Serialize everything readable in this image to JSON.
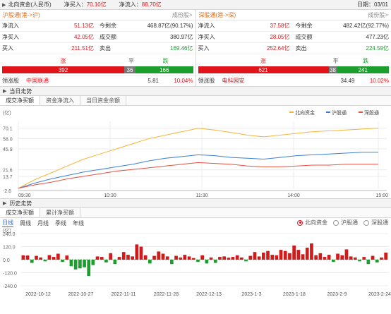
{
  "topbar": {
    "title": "北向资金(人民币)",
    "net_buy_label": "净买入：",
    "net_buy_value": "70.10亿",
    "net_inflow_label": "净流入：",
    "net_inflow_value": "88.70亿",
    "date_label": "日期：",
    "date_value": "03/01"
  },
  "left_panel": {
    "title": "沪股通(港->沪)",
    "more": "成份股>",
    "rows": [
      {
        "l1": "净流入",
        "v1": "51.13亿",
        "l2": "今剩余",
        "v2": "468.87亿(90.17%)"
      },
      {
        "l1": "净买入",
        "v1": "42.05亿",
        "l2": "成交额",
        "v2": "380.97亿"
      },
      {
        "l1": "买入",
        "v1": "211.51亿",
        "l2": "卖出",
        "v2": "169.46亿"
      }
    ],
    "up_label": "涨",
    "flat_label": "平",
    "down_label": "跌",
    "up_count": "392",
    "flat_count": "36",
    "down_count": "166",
    "lead_label": "领涨股",
    "lead_name": "中国联通",
    "lead_price": "5.81",
    "lead_pct": "10.04%"
  },
  "right_panel": {
    "title": "深股通(港->深)",
    "more": "成份股>",
    "rows": [
      {
        "l1": "净流入",
        "v1": "37.58亿",
        "l2": "今剩余",
        "v2": "482.42亿(92.77%)"
      },
      {
        "l1": "净买入",
        "v1": "28.05亿",
        "l2": "成交额",
        "v2": "477.23亿"
      },
      {
        "l1": "买入",
        "v1": "252.64亿",
        "l2": "卖出",
        "v2": "224.59亿"
      }
    ],
    "up_label": "涨",
    "flat_label": "平",
    "down_label": "跌",
    "up_count": "621",
    "flat_count": "38",
    "down_count": "241",
    "lead_label": "领涨股",
    "lead_name": "电科网安",
    "lead_price": "34.49",
    "lead_pct": "10.02%"
  },
  "intraday_section": {
    "title": "当日走势",
    "tabs": [
      "成交净买额",
      "资金净流入",
      "当日资金余额"
    ]
  },
  "history_section": {
    "title": "历史走势",
    "tabs": [
      "成交净买额",
      "累计净买额"
    ],
    "periods": [
      "日线",
      "周线",
      "月线",
      "季线",
      "年线"
    ],
    "radios": [
      "北向资金",
      "沪股通",
      "深股通"
    ]
  },
  "chart_data": [
    {
      "type": "line",
      "unit_label": "(亿)",
      "y_ticks": [
        -2.6,
        13.7,
        21.6,
        45.9,
        58.0,
        70.1
      ],
      "ylim": [
        -2.6,
        78
      ],
      "x_tick_labels": [
        "09:30",
        "10:30",
        "11:30",
        "14:00",
        "15:00"
      ],
      "legend": [
        "北向资金",
        "沪股通",
        "深股通"
      ],
      "series_colors": [
        "#f5b53a",
        "#3c7fd6",
        "#e8503f"
      ],
      "series": [
        {
          "name": "北向资金",
          "values": [
            0,
            10,
            18,
            26,
            34,
            40,
            46,
            52,
            58,
            62,
            66,
            70,
            68,
            65,
            62,
            60,
            62,
            64,
            66,
            67,
            68,
            69,
            70.1
          ]
        },
        {
          "name": "沪股通",
          "values": [
            0,
            6,
            11,
            15,
            19,
            22,
            25,
            28,
            32,
            35,
            37,
            39,
            38,
            36,
            35,
            34,
            36,
            38,
            39,
            40,
            41,
            42,
            42
          ]
        },
        {
          "name": "深股通",
          "values": [
            0,
            4,
            7,
            11,
            14,
            17,
            20,
            22,
            24,
            26,
            28,
            30,
            29,
            28,
            26,
            25,
            25,
            26,
            27,
            27,
            28,
            28,
            28
          ]
        }
      ]
    },
    {
      "type": "bar",
      "unit_label": "(亿)",
      "y_ticks": [
        -240.0,
        -120.0,
        0.0,
        120.0,
        240.0
      ],
      "ylim": [
        -240,
        240
      ],
      "x_tick_labels": [
        "2022-10-12",
        "2022-10-27",
        "2022-11-11",
        "2022-11-28",
        "2022-12-13",
        "2023-1-3",
        "2023-1-18",
        "2023-2-9",
        "2023-2-24"
      ],
      "values": [
        40,
        38,
        -30,
        35,
        20,
        -15,
        42,
        25,
        55,
        -20,
        38,
        -60,
        -90,
        -80,
        -70,
        -150,
        -50,
        30,
        25,
        -25,
        60,
        -40,
        25,
        70,
        45,
        30,
        140,
        120,
        40,
        -35,
        35,
        75,
        55,
        30,
        -40,
        35,
        20,
        45,
        30,
        15,
        -20,
        40,
        -35,
        20,
        -30,
        25,
        30,
        18,
        25,
        40,
        20,
        -15,
        35,
        70,
        30,
        65,
        80,
        45,
        40,
        90,
        80,
        60,
        130,
        90,
        50,
        110,
        150,
        40,
        60,
        25,
        45,
        -20,
        55,
        40,
        95,
        30,
        20,
        -15,
        25,
        -40,
        35,
        -25,
        20,
        65
      ]
    }
  ]
}
